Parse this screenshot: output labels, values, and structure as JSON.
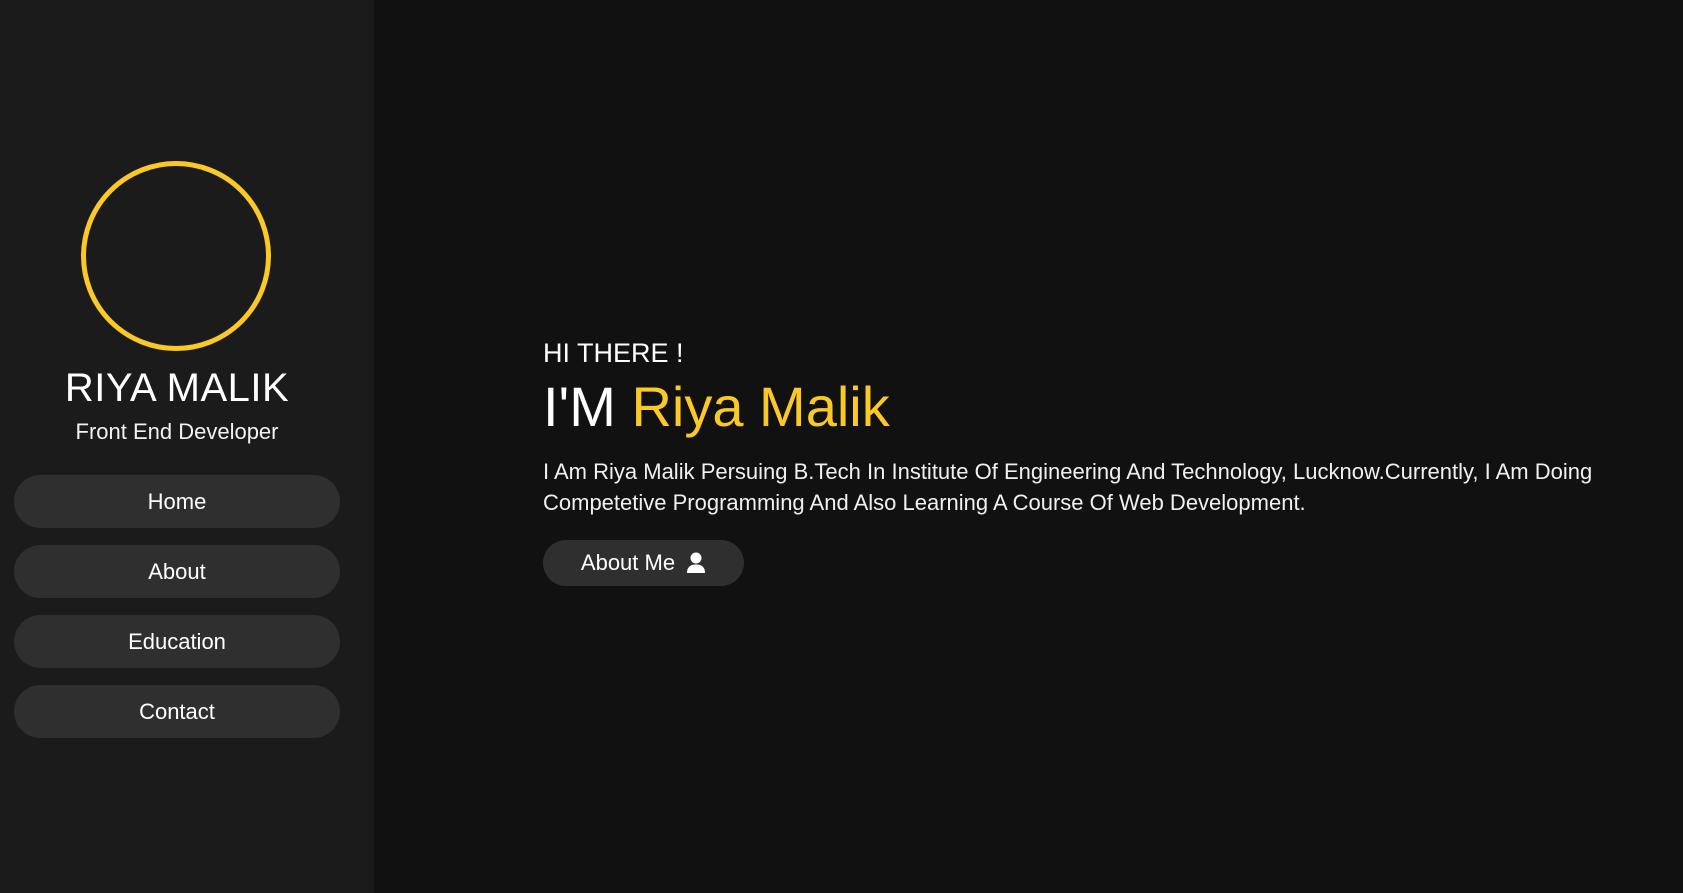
{
  "sidebar": {
    "name": "RIYA MALIK",
    "role": "Front End Developer",
    "nav": [
      {
        "label": "Home"
      },
      {
        "label": "About"
      },
      {
        "label": "Education"
      },
      {
        "label": "Contact"
      }
    ]
  },
  "hero": {
    "greeting": "HI THERE !",
    "title_prefix": "I'M",
    "title_name": "Riya Malik",
    "description": "I Am Riya Malik Persuing B.Tech In Institute Of Engineering And Technology, Lucknow.Currently, I Am Doing Competetive Programming And Also Learning A Course Of Web Development.",
    "cta_label": "About Me",
    "cta_icon": "user-icon"
  },
  "colors": {
    "accent": "#fbc926",
    "sidebar_bg": "#1b1b1b",
    "main_bg": "#111111",
    "button_bg": "#2f2f2f"
  }
}
